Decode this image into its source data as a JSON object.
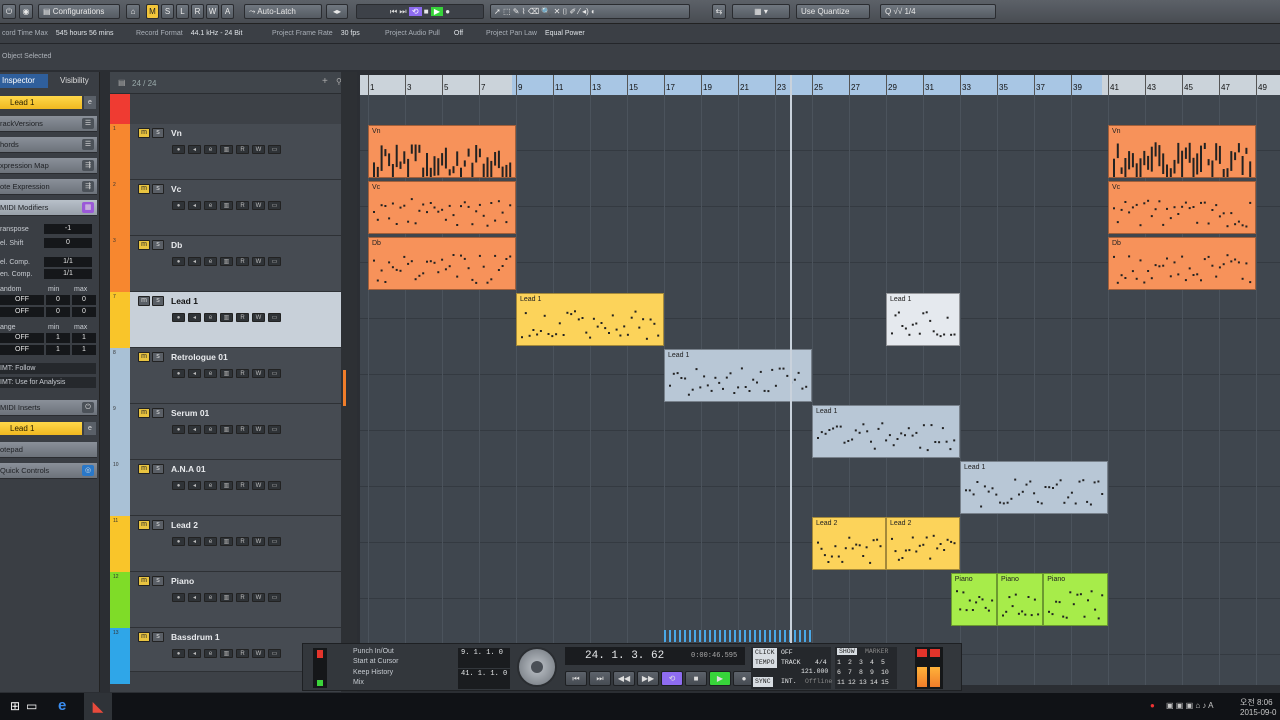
{
  "toolbar": {
    "configurations_label": "Configurations",
    "modes": [
      "M",
      "S",
      "L",
      "R",
      "W",
      "A"
    ],
    "automation_mode": "Auto-Latch",
    "quantize_label": "Use Quantize",
    "quantize_value": "1/4"
  },
  "project_info": [
    {
      "label": "cord Time Max",
      "value": "545 hours 56 mins"
    },
    {
      "label": "Record Format",
      "value": "44.1 kHz - 24 Bit"
    },
    {
      "label": "Project Frame Rate",
      "value": "30 fps"
    },
    {
      "label": "Project Audio Pull",
      "value": "Off"
    },
    {
      "label": "Project Pan Law",
      "value": "Equal Power"
    }
  ],
  "status": {
    "selection": "Object Selected"
  },
  "inspector": {
    "tabs": [
      "Inspector",
      "Visibility"
    ],
    "track_name": "Lead 1",
    "sections": [
      "rackVersions",
      "hords",
      "xpression Map",
      "ote Expression",
      "MIDI Modifiers"
    ],
    "params": [
      {
        "label": "ranspose",
        "value": "-1"
      },
      {
        "label": "el. Shift",
        "value": "0"
      },
      {
        "label": "el. Comp.",
        "value": "1/1"
      },
      {
        "label": "en. Comp.",
        "value": "1/1"
      }
    ],
    "random_header": [
      "andom",
      "min",
      "max"
    ],
    "random_rows": [
      [
        "OFF",
        "0",
        "0"
      ],
      [
        "OFF",
        "0",
        "0"
      ]
    ],
    "range_header": [
      "ange",
      "min",
      "max"
    ],
    "range_rows": [
      [
        "OFF",
        "1",
        "1"
      ],
      [
        "OFF",
        "1",
        "1"
      ]
    ],
    "hmt_follow": "IMT: Follow",
    "hmt_analysis": "IMT: Use for Analysis",
    "inserts_label": "MIDI Inserts",
    "insert_track": "Lead 1",
    "notepad_label": "otepad",
    "quick_controls_label": "Quick Controls"
  },
  "tracklist": {
    "count": "24 / 24",
    "tracks": [
      {
        "num": "1",
        "name": "Vn",
        "color": "#f7872f"
      },
      {
        "num": "2",
        "name": "Vc",
        "color": "#f7872f"
      },
      {
        "num": "3",
        "name": "Db",
        "color": "#f7872f"
      },
      {
        "num": "7",
        "name": "Lead 1",
        "color": "#f9c52a"
      },
      {
        "num": "8",
        "name": "Retrologue 01",
        "color": "#a9c1d6"
      },
      {
        "num": "9",
        "name": "Serum 01",
        "color": "#a9c1d6"
      },
      {
        "num": "10",
        "name": "A.N.A 01",
        "color": "#a9c1d6"
      },
      {
        "num": "11",
        "name": "Lead 2",
        "color": "#f9c52a"
      },
      {
        "num": "12",
        "name": "Piano",
        "color": "#7fdc28"
      },
      {
        "num": "13",
        "name": "Bassdrum 1",
        "color": "#2fa6e8"
      }
    ]
  },
  "ruler": {
    "bars": [
      "1",
      "3",
      "5",
      "7",
      "9",
      "11",
      "13",
      "15",
      "17",
      "19",
      "21",
      "23",
      "25",
      "27",
      "29",
      "31",
      "33",
      "35",
      "37",
      "39",
      "41",
      "43",
      "45",
      "47",
      "49"
    ]
  },
  "parts": [
    {
      "lane": 0,
      "start": 1,
      "len": 8,
      "label": "Vn",
      "color": "orange"
    },
    {
      "lane": 0,
      "start": 41,
      "len": 8,
      "label": "Vn",
      "color": "orange"
    },
    {
      "lane": 1,
      "start": 1,
      "len": 8,
      "label": "Vc",
      "color": "orange"
    },
    {
      "lane": 1,
      "start": 41,
      "len": 8,
      "label": "Vc",
      "color": "orange"
    },
    {
      "lane": 2,
      "start": 1,
      "len": 8,
      "label": "Db",
      "color": "orange"
    },
    {
      "lane": 2,
      "start": 41,
      "len": 8,
      "label": "Db",
      "color": "orange"
    },
    {
      "lane": 3,
      "start": 9,
      "len": 8,
      "label": "Lead 1",
      "color": "yellow"
    },
    {
      "lane": 3,
      "start": 29,
      "len": 4,
      "label": "Lead 1",
      "color": "white"
    },
    {
      "lane": 4,
      "start": 17,
      "len": 8,
      "label": "Lead 1",
      "color": "bluegray"
    },
    {
      "lane": 5,
      "start": 25,
      "len": 8,
      "label": "Lead 1",
      "color": "bluegray"
    },
    {
      "lane": 6,
      "start": 33,
      "len": 8,
      "label": "Lead 1",
      "color": "bluegray"
    },
    {
      "lane": 7,
      "start": 25,
      "len": 4,
      "label": "Lead 2",
      "color": "yellow"
    },
    {
      "lane": 7,
      "start": 29,
      "len": 4,
      "label": "Lead 2",
      "color": "yellow"
    },
    {
      "lane": 8,
      "start": 32.5,
      "len": 2.5,
      "label": "Piano",
      "color": "green"
    },
    {
      "lane": 8,
      "start": 35,
      "len": 2.5,
      "label": "Piano",
      "color": "green"
    },
    {
      "lane": 8,
      "start": 37.5,
      "len": 3.5,
      "label": "Piano",
      "color": "green"
    }
  ],
  "transport": {
    "punch": "Punch In/Out",
    "start_cursor": "Start at Cursor",
    "keep_history": "Keep History",
    "mix": "Mix",
    "left_locator": "9. 1. 1.   0",
    "right_locator": "41. 1. 1.   0",
    "position": "24.  1.  3.  62",
    "time": "0:00:46.595",
    "click": "CLICK",
    "click_state": "OFF",
    "tempo": "TEMPO",
    "tempo_mode": "TRACK",
    "signature": "4/4",
    "tempo_value": "121.000",
    "sync": "SYNC",
    "sync_mode": "INT.",
    "sync_state": "Offline",
    "show": "SHOW",
    "marker": "MARKER",
    "markers": [
      "1",
      "2",
      "3",
      "4",
      "5",
      "6",
      "7",
      "8",
      "9",
      "10",
      "11",
      "12",
      "13",
      "14",
      "15"
    ]
  },
  "taskbar": {
    "clock_line1": "오전 8:06",
    "clock_line2": "2015-09-0"
  }
}
